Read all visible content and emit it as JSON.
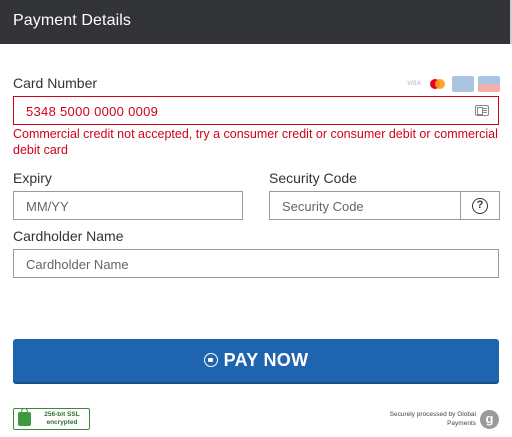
{
  "header": {
    "title": "Payment Details"
  },
  "card_number": {
    "label": "Card Number",
    "value": "5348 5000 0000 0009",
    "error": "Commercial credit not accepted, try a consumer credit or consumer debit or commercial debit card",
    "accepted_brands": [
      "VISA",
      "Mastercard",
      "American Express",
      "Diners"
    ]
  },
  "expiry": {
    "label": "Expiry",
    "placeholder": "MM/YY"
  },
  "security_code": {
    "label": "Security Code",
    "placeholder": "Security Code",
    "help_symbol": "?"
  },
  "cardholder": {
    "label": "Cardholder Name",
    "placeholder": "Cardholder Name"
  },
  "pay_button": {
    "label": "PAY NOW"
  },
  "footer": {
    "ssl_badge": "256-bit SSL encrypted",
    "processor": "Securely processed by Global Payments",
    "processor_logo": "g"
  },
  "colors": {
    "header_bg": "#333438",
    "error": "#d0021b",
    "pay_button": "#1e64ae",
    "ssl_green": "#3e9a3e"
  }
}
